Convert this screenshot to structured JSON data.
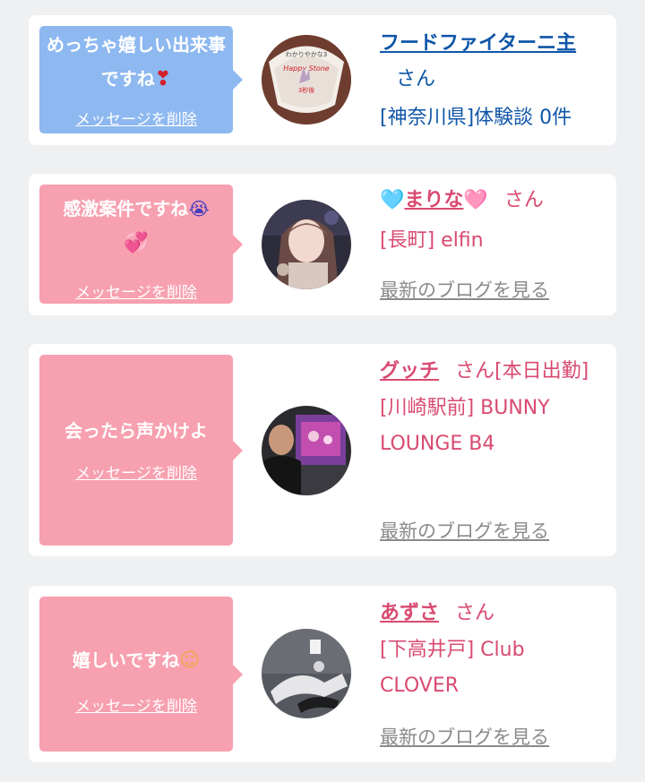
{
  "colors": {
    "page_bg": "#eff0f2",
    "bubble_blue": "#8db8f0",
    "bubble_pink": "#f7a0b0",
    "name_blue": "#0f56a8",
    "name_pink": "#d94a70",
    "blog_link": "#8a8a8a"
  },
  "honorific": "さん",
  "delete_label": "メッセージを削除",
  "blog_label": "最新のブログを見る",
  "cards": [
    {
      "message": "めっちゃ嬉しい出来事ですね",
      "message_emoji": "❣",
      "name": "フードファイターニ主",
      "location": "[神奈川県]体験談 0件",
      "avatar_text": "わかりやかな3 Happy Stone 3秒後"
    },
    {
      "message": "感激案件ですね",
      "message_emoji": "💞",
      "name_prefix": "🩵",
      "name": "まりな",
      "name_suffix": "🩷",
      "location": "[長町] elfin"
    },
    {
      "message": "会ったら声かけよ",
      "name": "グッチ",
      "name_extra": "[本日出勤]",
      "location": "[川崎駅前] BUNNY LOUNGE B4"
    },
    {
      "message": "嬉しいですね",
      "message_emoji": "☺",
      "name": "あずさ",
      "location": "[下高井戸] Club CLOVER"
    }
  ]
}
